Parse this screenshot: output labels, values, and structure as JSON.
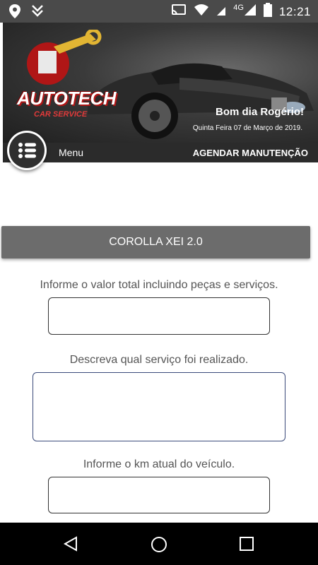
{
  "status_bar": {
    "time": "12:21",
    "network": "4G",
    "icons": [
      "location-pin-icon",
      "download-icon",
      "cast-icon",
      "wifi-icon",
      "signal-icon",
      "battery-icon"
    ]
  },
  "header": {
    "logo_brand": "AUTOTECH",
    "logo_sub": "CAR SERVICE",
    "greeting": "Bom dia Rogério!",
    "date": "Quinta Feira 07 de Março de 2019."
  },
  "menu": {
    "label": "Menu",
    "schedule_link": "AGENDAR MANUTENÇÃO"
  },
  "vehicle": {
    "name": "COROLLA XEI 2.0"
  },
  "form": {
    "value_label": "Informe o valor total incluindo peças e serviços.",
    "value_input": "",
    "service_label": "Descreva qual serviço foi realizado.",
    "service_input": "",
    "km_label": "Informe o km atual do veículo.",
    "km_input": ""
  },
  "nav": {
    "icons": [
      "back-icon",
      "home-icon",
      "recents-icon"
    ]
  }
}
